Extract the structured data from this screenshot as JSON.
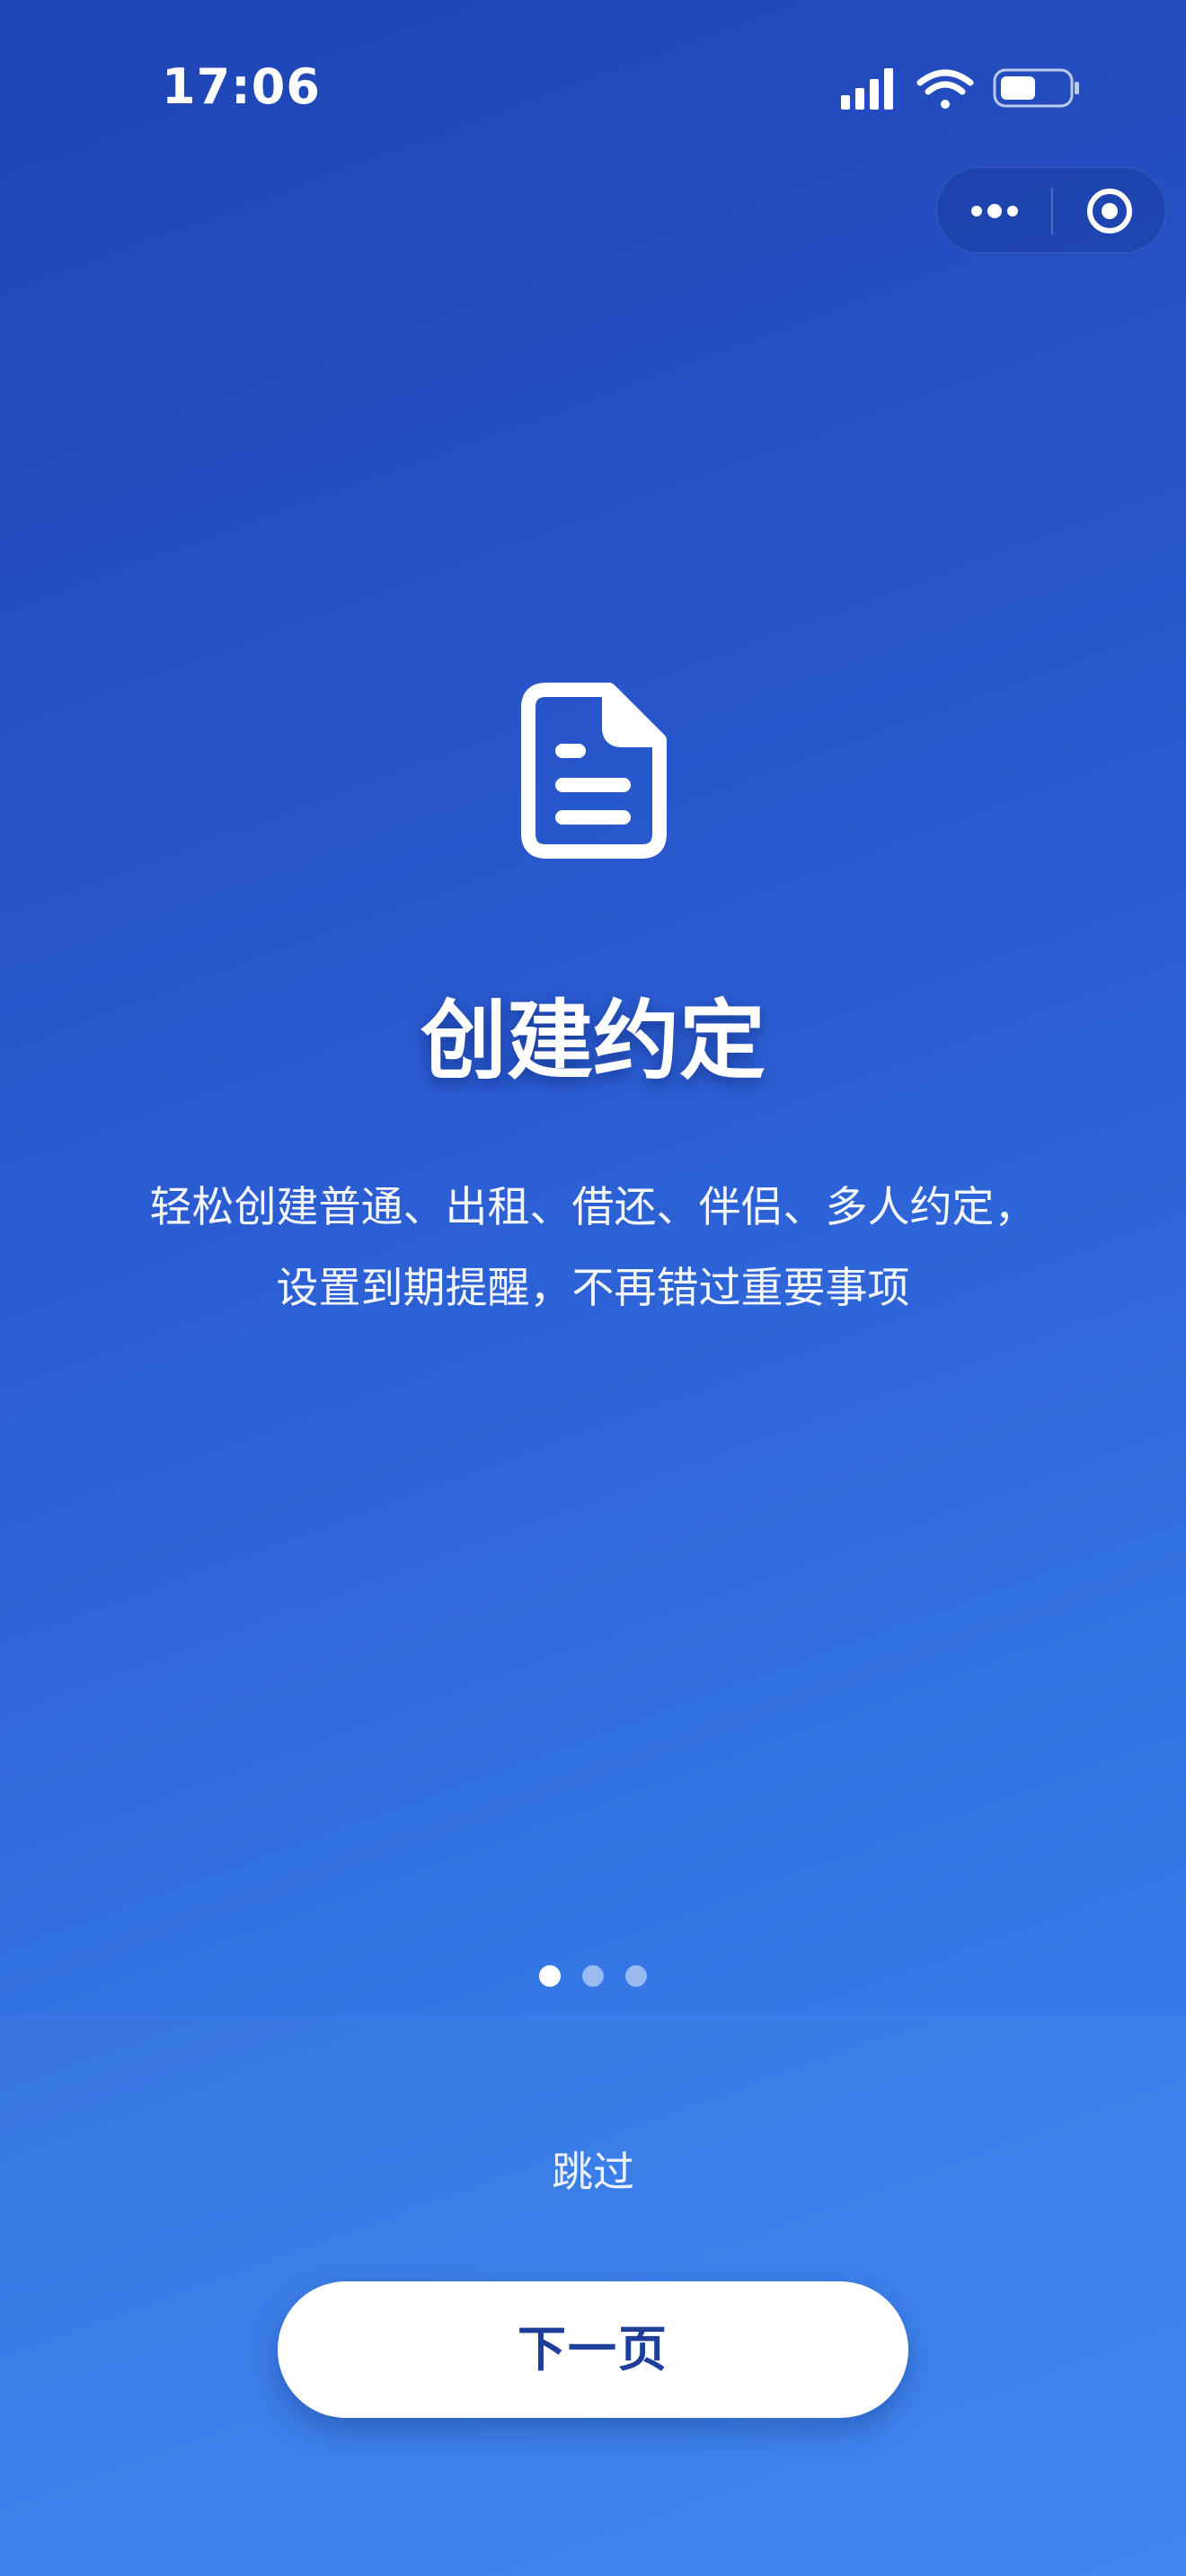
{
  "status_bar": {
    "time": "17:06"
  },
  "capsule": {
    "more_icon": "more-dots-icon",
    "close_icon": "target-circle-icon"
  },
  "hero": {
    "icon": "document-icon",
    "title": "创建约定",
    "description": "轻松创建普通、出租、借还、伴侣、多人约定，设置到期提醒，不再错过重要事项"
  },
  "pager": {
    "total": 3,
    "active_index": 0
  },
  "actions": {
    "skip_label": "跳过",
    "next_label": "下一页"
  },
  "colors": {
    "gradient_start": "#1f44b4",
    "gradient_end": "#3b82f3",
    "button_text": "#1f3e9a",
    "button_bg": "#ffffff"
  }
}
